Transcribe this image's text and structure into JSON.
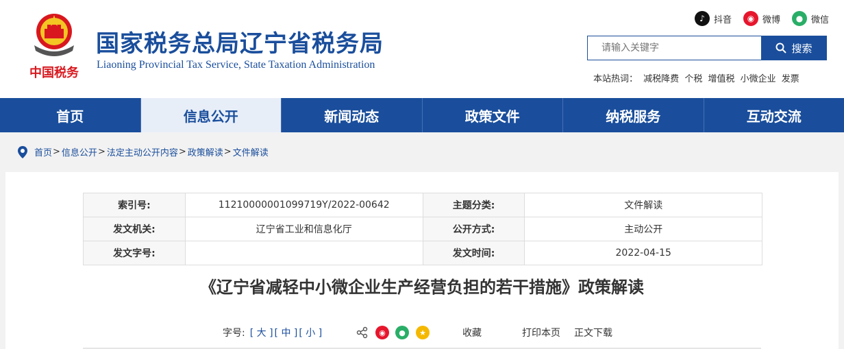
{
  "header": {
    "title": "国家税务总局辽宁省税务局",
    "subtitle": "Liaoning Provincial Tax Service, State Taxation Administration",
    "emblem_text": "中国税务"
  },
  "social": {
    "douyin": "抖音",
    "weibo": "微博",
    "wechat": "微信"
  },
  "search": {
    "placeholder": "请输入关键字",
    "button": "搜索"
  },
  "hot": {
    "label": "本站热词：",
    "terms": [
      "减税降费",
      "个税",
      "增值税",
      "小微企业",
      "发票"
    ]
  },
  "nav": {
    "items": [
      "首页",
      "信息公开",
      "新闻动态",
      "政策文件",
      "纳税服务",
      "互动交流"
    ],
    "active_index": 1
  },
  "breadcrumb": {
    "items": [
      "首页",
      "信息公开",
      "法定主动公开内容",
      "政策解读",
      "文件解读"
    ],
    "separator": ">"
  },
  "meta": {
    "index_label": "索引号:",
    "index_value": "11210000001099719Y/2022-00642",
    "topic_label": "主题分类:",
    "topic_value": "文件解读",
    "issuer_label": "发文机关:",
    "issuer_value": "辽宁省工业和信息化厅",
    "publicity_label": "公开方式:",
    "publicity_value": "主动公开",
    "doc_no_label": "发文字号:",
    "doc_no_value": "",
    "date_label": "发文时间:",
    "date_value": "2022-04-15"
  },
  "article": {
    "title": "《辽宁省减轻中小微企业生产经营负担的若干措施》政策解读"
  },
  "tools": {
    "font_label": "字号:",
    "large": "[ 大 ]",
    "medium": "[ 中 ]",
    "small": "[ 小 ]",
    "favorite": "收藏",
    "print": "打印本页",
    "download": "正文下载"
  },
  "colors": {
    "brand": "#1a4e9c",
    "weibo": "#e6162d",
    "wechat": "#2aae67",
    "star": "#f5b800"
  }
}
